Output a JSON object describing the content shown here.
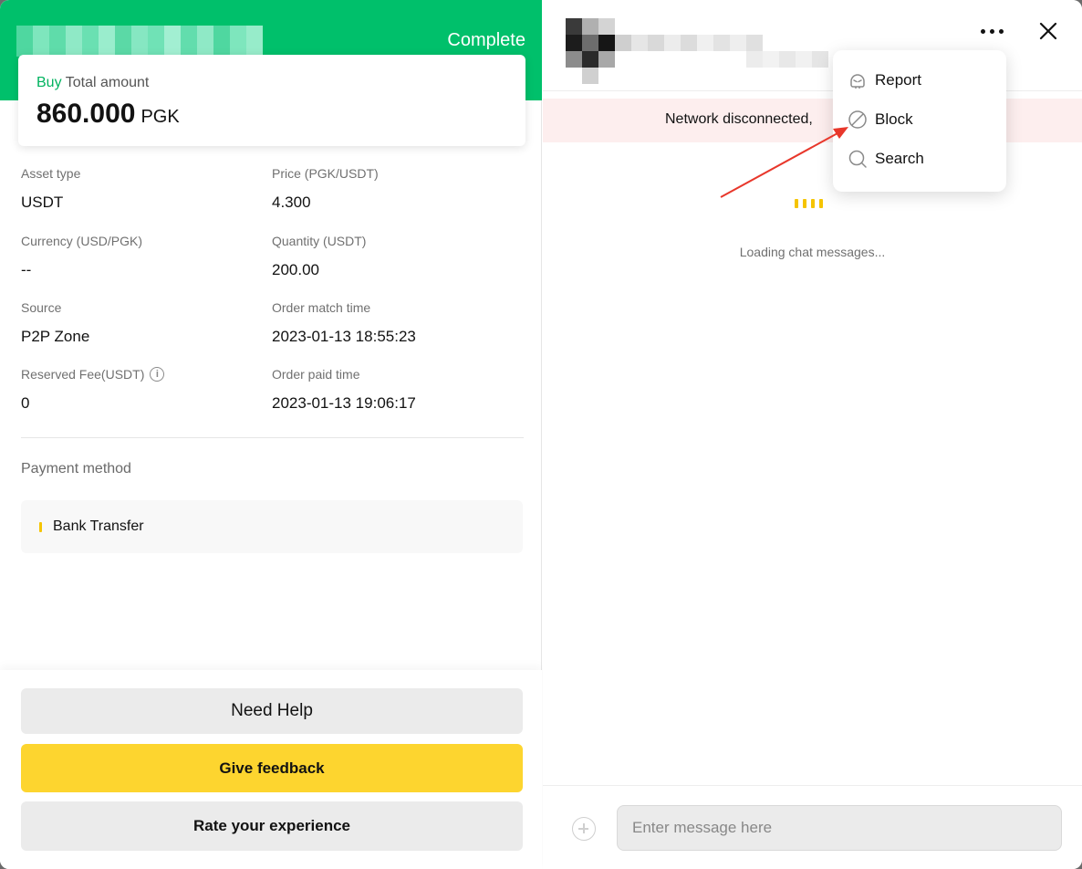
{
  "order": {
    "status": "Complete",
    "amount_label_side": "Buy",
    "amount_label": "Total amount",
    "amount_value": "860.000",
    "amount_currency": "PGK"
  },
  "details": [
    {
      "label": "Asset type",
      "value": "USDT"
    },
    {
      "label": "Price (PGK/USDT)",
      "value": "4.300"
    },
    {
      "label": "Currency (USD/PGK)",
      "value": "--"
    },
    {
      "label": "Quantity (USDT)",
      "value": "200.00"
    },
    {
      "label": "Source",
      "value": "P2P Zone"
    },
    {
      "label": "Order match time",
      "value": "2023-01-13 18:55:23"
    },
    {
      "label": "Reserved Fee(USDT)",
      "value": "0"
    },
    {
      "label": "Order paid time",
      "value": "2023-01-13 19:06:17"
    }
  ],
  "payment": {
    "title": "Payment method",
    "method": "Bank Transfer"
  },
  "actions": {
    "need_help": "Need Help",
    "give_feedback": "Give feedback",
    "rate_experience": "Rate your experience"
  },
  "chat": {
    "banner": "Network disconnected,",
    "loading": "Loading chat messages...",
    "input_placeholder": "Enter message here"
  },
  "menu": {
    "report": "Report",
    "block": "Block",
    "search": "Search"
  },
  "colors": {
    "header_green": "#00c06b",
    "accent_yellow": "#fdd52f",
    "buy_green": "#00b35f",
    "banner_pink": "#fdeeee",
    "annotation_red": "#e8372b"
  }
}
